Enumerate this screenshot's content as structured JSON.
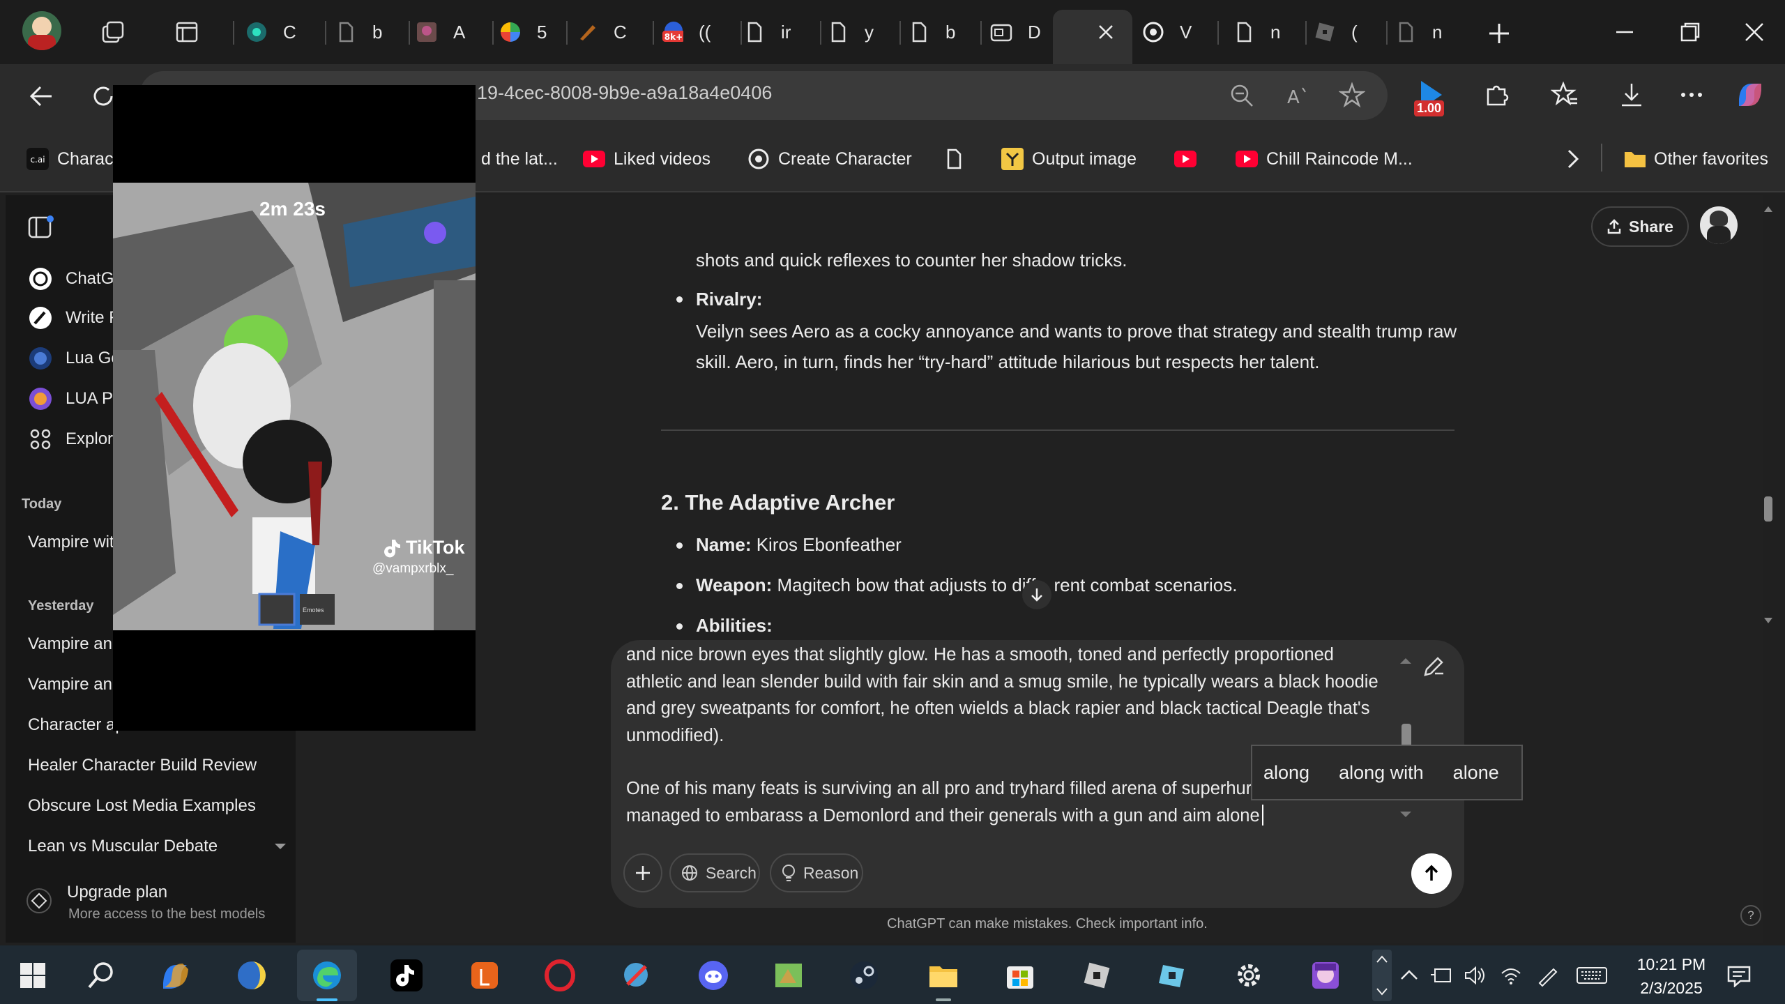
{
  "browser": {
    "tabs": [
      {
        "title": "C"
      },
      {
        "title": "b"
      },
      {
        "title": "A"
      },
      {
        "title": "5"
      },
      {
        "title": "C"
      },
      {
        "title": "(("
      },
      {
        "title": "ir"
      },
      {
        "title": "y"
      },
      {
        "title": "b"
      },
      {
        "title": "D"
      },
      {
        "title": ""
      },
      {
        "title": "V"
      },
      {
        "title": "n"
      },
      {
        "title": "("
      },
      {
        "title": "n"
      }
    ],
    "url": "19-4cec-8008-9b9e-a9a18a4e0406",
    "extension_badge": "1.00",
    "bookmarks": [
      {
        "label": "Charact"
      },
      {
        "label": "d the lat..."
      },
      {
        "label": "Liked videos"
      },
      {
        "label": "Create Character"
      },
      {
        "label": ""
      },
      {
        "label": "Output image"
      },
      {
        "label": ""
      },
      {
        "label": "Chill Raincode M..."
      },
      {
        "label": "Other favorites"
      }
    ]
  },
  "sidebar": {
    "pinned": [
      {
        "label": "ChatGPT"
      },
      {
        "label": "Write F"
      },
      {
        "label": "Lua Go"
      },
      {
        "label": "LUA Pr"
      },
      {
        "label": "Explore"
      }
    ],
    "today_label": "Today",
    "today": [
      {
        "label": "Vampire with"
      }
    ],
    "yesterday_label": "Yesterday",
    "yesterday": [
      {
        "label": "Vampire and"
      },
      {
        "label": "Vampire and"
      },
      {
        "label": "Character ap"
      },
      {
        "label": "Healer Character Build Review"
      },
      {
        "label": "Obscure Lost Media Examples"
      },
      {
        "label": "Lean vs Muscular Debate"
      }
    ],
    "upgrade": {
      "title": "Upgrade plan",
      "subtitle": "More access to the best models"
    }
  },
  "chat": {
    "share_label": "Share",
    "line_top": "shots and quick reflexes to counter her shadow tricks.",
    "rivalry_label": "Rivalry:",
    "rivalry_l1": "Veilyn sees Aero as a cocky annoyance and wants to prove that strategy and stealth trump raw",
    "rivalry_l2": "skill. Aero, in turn, finds her “try-hard” attitude hilarious but respects her talent.",
    "section_heading": "2. The Adaptive Archer",
    "name_label": "Name:",
    "name_value": " Kiros Ebonfeather",
    "weapon_label": "Weapon:",
    "weapon_value": " Magitech bow that adjusts to diff",
    "weapon_value_end": "rent combat scenarios.",
    "abilities_label": "Abilities:"
  },
  "composer": {
    "lines": [
      "and nice brown eyes that slightly glow. He has a smooth, toned and perfectly proportioned",
      "athletic and lean slender build with fair skin and a smug smile, he typically wears a black hoodie",
      "and grey sweatpants for comfort, he often wields a black rapier and black tactical Deagle that's",
      "unmodified).",
      "",
      "One of his many feats is surviving an all pro and tryhard filled arena of superhur",
      "managed to embarass a Demonlord and their generals with a gun and aim alone"
    ],
    "search_label": "Search",
    "reason_label": "Reason",
    "suggestions": [
      "along",
      "along with",
      "alone"
    ],
    "disclaimer": "ChatGPT can make mistakes. Check important info.",
    "help": "?"
  },
  "video": {
    "timer": "2m 23s",
    "brand": "TikTok",
    "handle": "@vampxrblx_",
    "emotes": "Emotes"
  },
  "taskbar": {
    "time": "10:21 PM",
    "date": "2/3/2025"
  },
  "colors": {
    "accent_blue": "#1e88e5",
    "youtube_red": "#ff0033",
    "folder_yellow": "#f5c242"
  }
}
